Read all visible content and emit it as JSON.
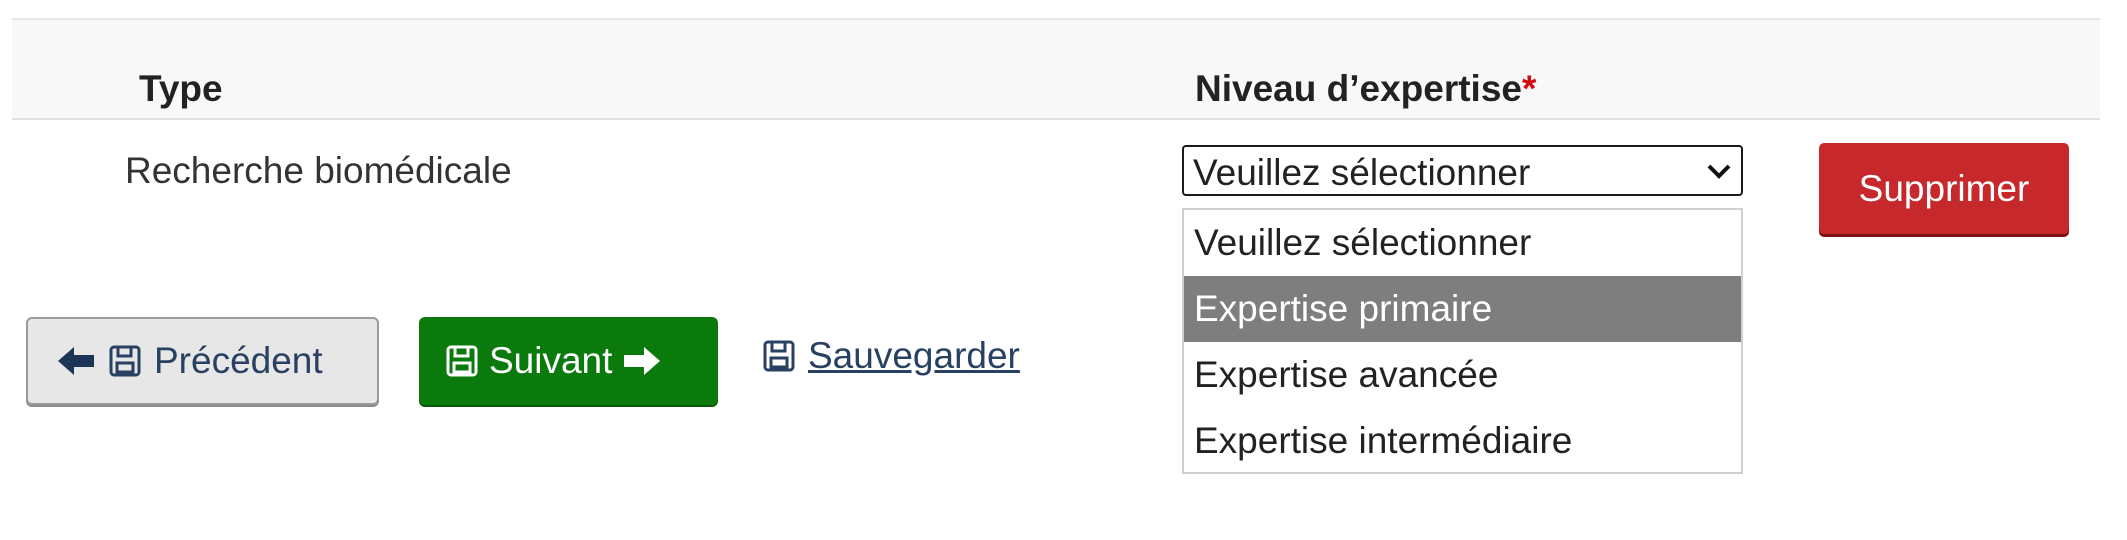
{
  "table": {
    "headers": {
      "type": "Type",
      "level": "Niveau d’expertise",
      "required_mark": "*"
    },
    "row": {
      "type": "Recherche biomédicale",
      "select": {
        "value": "Veuillez sélectionner",
        "options": [
          "Veuillez sélectionner",
          "Expertise primaire",
          "Expertise avancée",
          "Expertise intermédiaire"
        ],
        "highlighted_option": "Expertise primaire"
      },
      "delete_label": "Supprimer"
    }
  },
  "nav": {
    "previous_label": "Précédent",
    "next_label": "Suivant",
    "save_label": "Sauvegarder"
  },
  "colors": {
    "delete": "#c6282c",
    "next": "#0a7a0d",
    "link": "#284162",
    "required": "#d3080c",
    "highlight": "#7e7e7e"
  },
  "icons": {
    "previous": [
      "arrow-left-icon",
      "save-icon"
    ],
    "next": [
      "save-icon",
      "arrow-right-icon"
    ],
    "save": "save-icon",
    "select": "chevron-down-icon"
  }
}
